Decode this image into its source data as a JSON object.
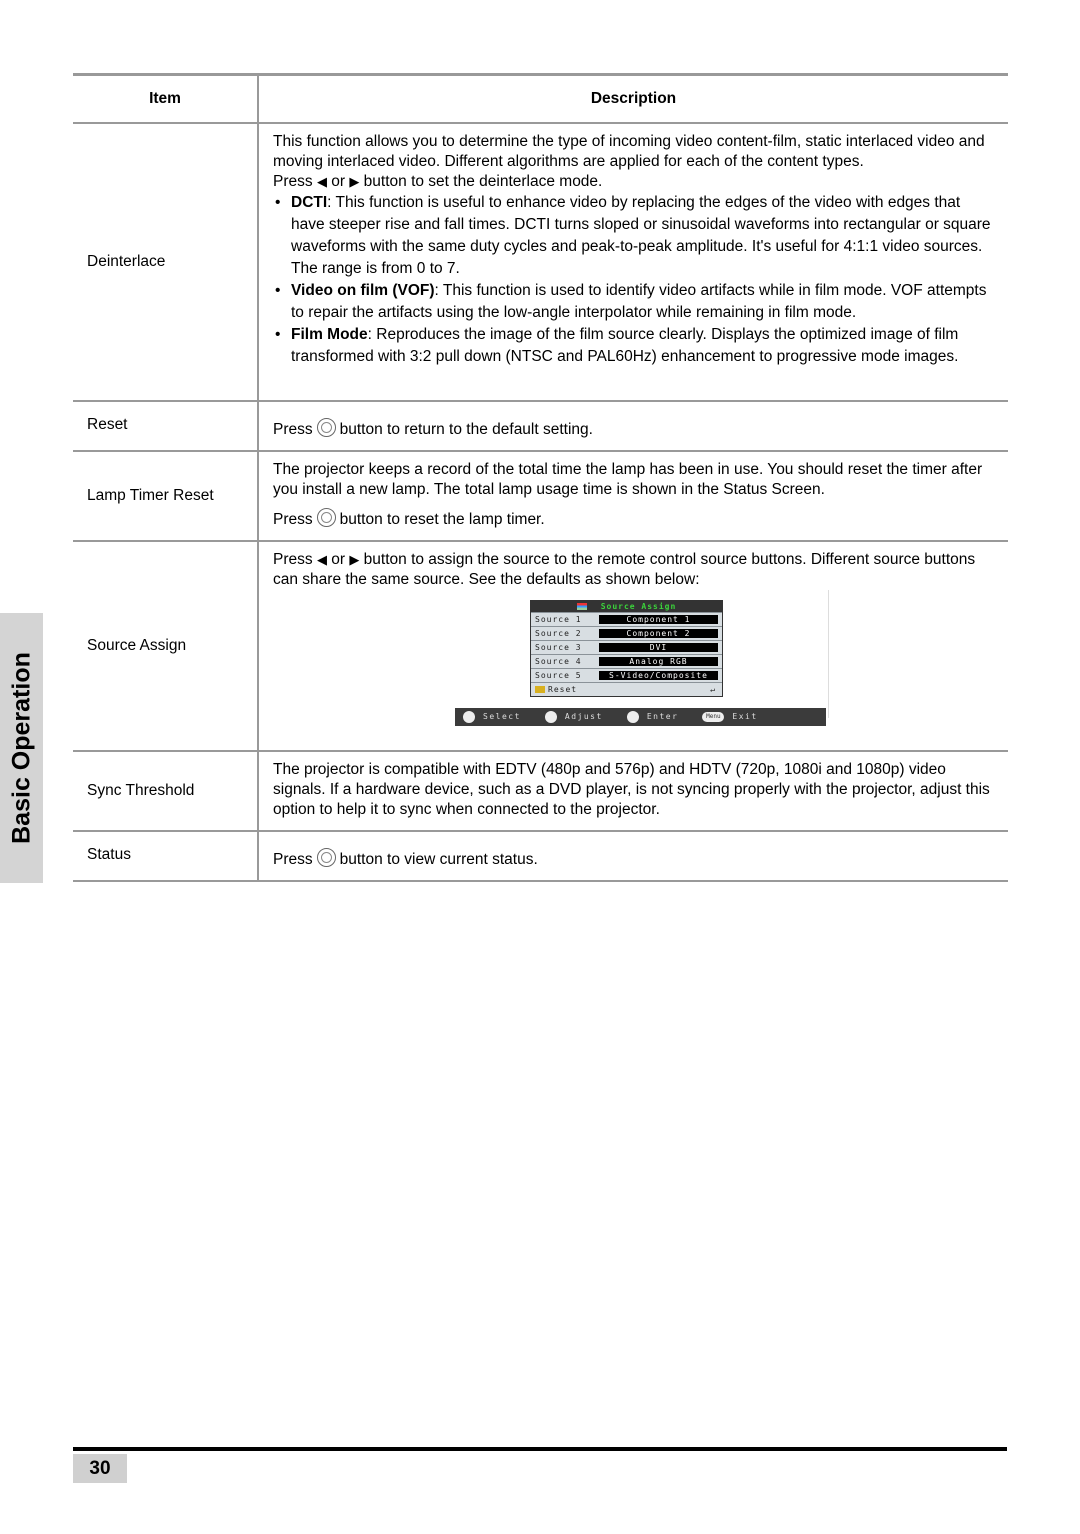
{
  "side_tab": {
    "label": "Basic Operation"
  },
  "table": {
    "headers": {
      "item": "Item",
      "description": "Description"
    },
    "deinterlace": {
      "item": "Deinterlace",
      "intro": "This function allows you to determine the type of incoming video content-film, static interlaced video and moving interlaced video. Different algorithms are applied for each of the content types.",
      "press_pre": "Press",
      "or": "or",
      "press_post": "button to set the deinterlace mode.",
      "bullets": [
        {
          "term": "DCTI",
          "text": ": This function is useful to enhance video by replacing the edges of the video with edges that have steeper rise and fall times. DCTI turns sloped or sinusoidal waveforms into rectangular or square waveforms with the same duty cycles and peak-to-peak amplitude. It's useful for 4:1:1 video sources. The range is from 0 to 7."
        },
        {
          "term": "Video on film (VOF)",
          "text": ": This function is used to identify video artifacts while in film mode. VOF attempts to repair the artifacts using the low-angle interpolator while remaining in film mode."
        },
        {
          "term": "Film Mode",
          "text": ": Reproduces the image of the film source clearly. Displays the optimized image of film transformed with 3:2 pull down (NTSC and PAL60Hz) enhancement to progressive mode images."
        }
      ]
    },
    "reset": {
      "item": "Reset",
      "press": "Press",
      "text": "button to return to the default setting."
    },
    "lamp_timer_reset": {
      "item": "Lamp Timer Reset",
      "text": "The projector keeps a record of the total time the lamp has been in use. You should reset the timer after you install a new lamp. The total lamp usage time is shown in the Status Screen.",
      "press": "Press",
      "press_text": "button to reset the lamp timer."
    },
    "source_assign": {
      "item": "Source Assign",
      "press": "Press",
      "or": "or",
      "text": "button to assign the source to the remote control source buttons. Different source buttons can share the same source. See the defaults as shown below:",
      "osd": {
        "title": "Source Assign",
        "rows": [
          {
            "label": "Source 1",
            "value": "Component 1"
          },
          {
            "label": "Source 2",
            "value": "Component 2"
          },
          {
            "label": "Source 3",
            "value": "DVI"
          },
          {
            "label": "Source 4",
            "value": "Analog RGB"
          },
          {
            "label": "Source 5",
            "value": "S-Video/Composite"
          }
        ],
        "reset_label": "Reset",
        "nav": {
          "select": "Select",
          "adjust": "Adjust",
          "enter": "Enter",
          "menu": "Menu",
          "exit": "Exit"
        }
      }
    },
    "sync_threshold": {
      "item": "Sync Threshold",
      "text": "The projector is compatible with EDTV (480p and 576p) and HDTV (720p, 1080i and 1080p) video signals. If a hardware device, such as a DVD player, is not syncing properly with the projector, adjust this option to help it to sync when connected to the projector."
    },
    "status": {
      "item": "Status",
      "press": "Press",
      "text": "button to view current status."
    }
  },
  "footer": {
    "page_number": "30"
  }
}
